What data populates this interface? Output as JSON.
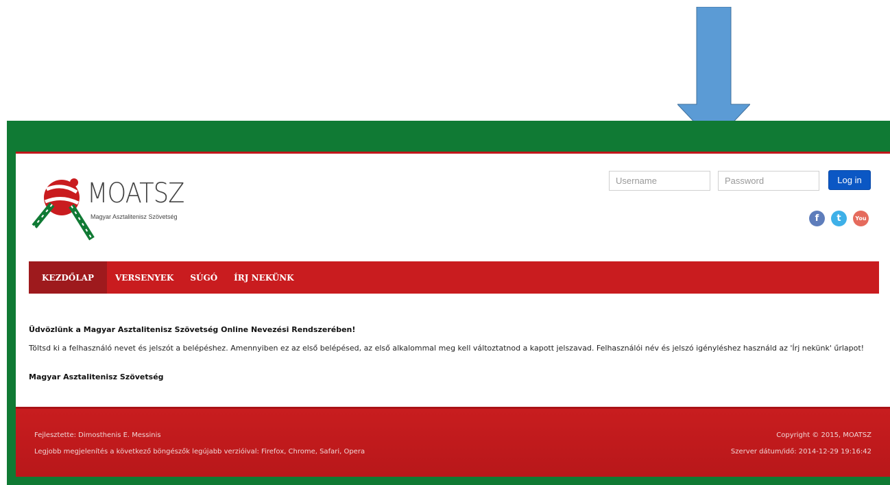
{
  "header": {
    "logo_title": "MOATSZ",
    "logo_subtitle": "Magyar Asztalitenisz Szövetség",
    "login": {
      "username_placeholder": "Username",
      "password_placeholder": "Password",
      "login_label": "Log in"
    },
    "social": [
      {
        "name": "facebook-icon",
        "glyph": "f"
      },
      {
        "name": "twitter-icon",
        "glyph": "t"
      },
      {
        "name": "youtube-icon",
        "glyph": "You"
      }
    ]
  },
  "nav": {
    "items": [
      {
        "label": "KEZDŐLAP",
        "active": true
      },
      {
        "label": "VERSENYEK",
        "active": false
      },
      {
        "label": "SÚGÓ",
        "active": false
      },
      {
        "label": "ÍRJ NEKÜNK",
        "active": false
      }
    ]
  },
  "main": {
    "welcome": "Üdvözlünk a Magyar Asztalitenisz Szövetség Online Nevezési Rendszerében!",
    "body": "Töltsd ki a felhasználó nevet és jelszót a belépéshez. Amennyiben ez az első belépésed, az első alkalommal meg kell változtatnod a kapott jelszavad. Felhasználói név és jelszó igényléshez használd az 'Írj nekünk' űrlapot!",
    "signature": "Magyar Asztalitenisz Szövetség"
  },
  "footer": {
    "developer": "Fejlesztette: Dimosthenis E. Messinis",
    "browsers": "Legjobb megjelenítés a következő böngészők legújabb verzióival: Firefox, Chrome, Safari, Opera",
    "copyright": "Copyright © 2015, MOATSZ",
    "server_time": "Szerver dátum/idő: 2014-12-29 19:16:42"
  },
  "colors": {
    "frame_green": "#107a34",
    "brand_red": "#c91c1f",
    "nav_active": "#9e1a1d",
    "login_blue": "#0b57c4",
    "arrow_blue": "#5b9bd5"
  }
}
